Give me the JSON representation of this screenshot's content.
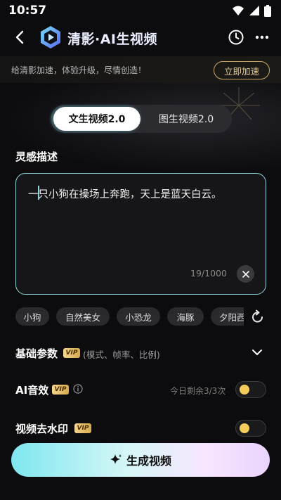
{
  "status_bar": {
    "time": "10:57"
  },
  "header": {
    "title": "清影·AI生视频"
  },
  "promo": {
    "text": "给清影加速，体验升级，尽情创造！",
    "button": "立即加速"
  },
  "mode_tabs": [
    {
      "label": "文生视频2.0",
      "active": true
    },
    {
      "label": "图生视频2.0",
      "active": false
    }
  ],
  "inspiration": {
    "label": "灵感描述",
    "prompt": "一只小狗在操场上奔跑，天上是蓝天白云。",
    "char_count": "19/1000"
  },
  "chips": [
    "小狗",
    "自然美女",
    "小恐龙",
    "海豚",
    "夕阳西下"
  ],
  "params": {
    "basic": {
      "title": "基础参数",
      "badge": "VIP",
      "subtitle": "(模式、帧率、比例)"
    },
    "ai_sound": {
      "title": "AI音效",
      "badge": "VIP",
      "quota": "今日剩余3/3次"
    },
    "watermark": {
      "title": "视频去水印",
      "badge": "VIP"
    }
  },
  "generate_button": {
    "label": "生成视频"
  },
  "colors": {
    "accent": "#8fd4dc",
    "vip_gold": "#e8cd94",
    "toggle_knob": "#f4cc5a"
  }
}
